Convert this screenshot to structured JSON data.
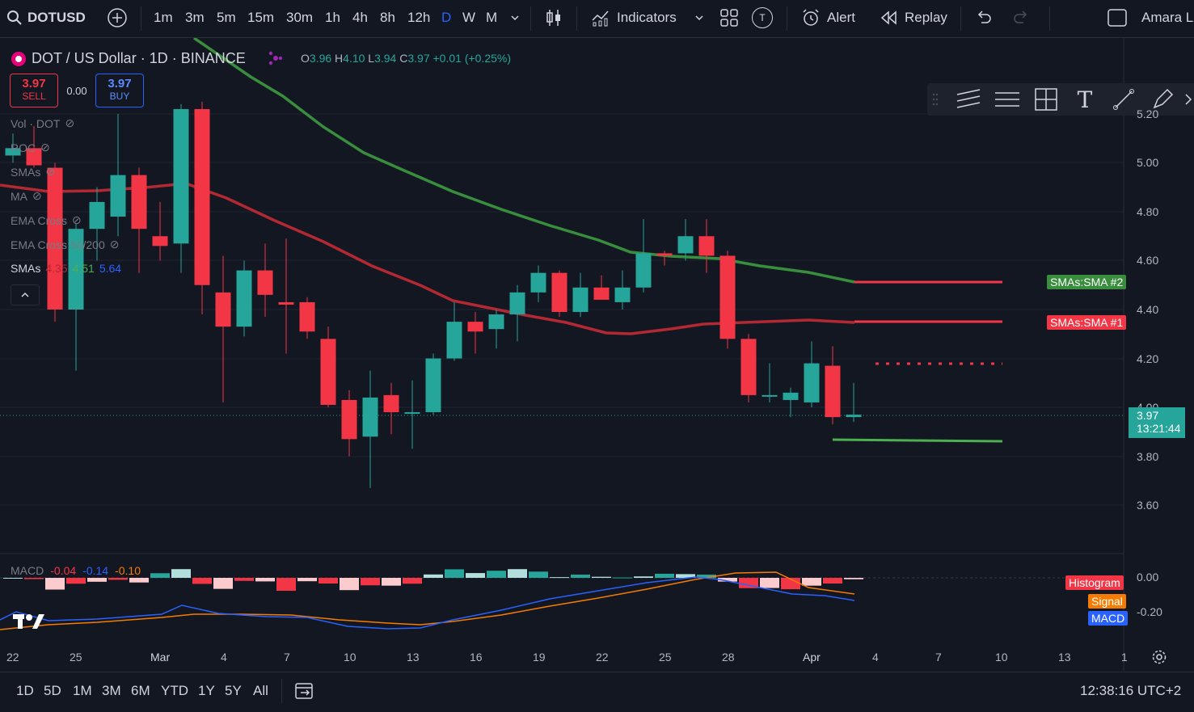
{
  "topbar": {
    "symbol": "DOTUSD",
    "intervals": [
      "1m",
      "3m",
      "5m",
      "15m",
      "30m",
      "1h",
      "4h",
      "8h",
      "12h",
      "D",
      "W",
      "M"
    ],
    "active_interval": "D",
    "indicators_label": "Indicators",
    "template_letter": "T",
    "alert_label": "Alert",
    "replay_label": "Replay",
    "user_label": "Amara L"
  },
  "header": {
    "title": "DOT / US Dollar · 1D · BINANCE",
    "ohlc": {
      "o_label": "O",
      "o": "3.96",
      "h_label": "H",
      "h": "4.10",
      "l_label": "L",
      "l": "3.94",
      "c_label": "C",
      "c": "3.97",
      "chg": "+0.01 (+0.25%)"
    },
    "sell_price": "3.97",
    "sell_label": "SELL",
    "spread": "0.00",
    "buy_price": "3.97",
    "buy_label": "BUY"
  },
  "legend": {
    "items": [
      "Vol · DOT",
      "ROC",
      "SMAs",
      "MA",
      "EMA Cross",
      "EMA Cross 50/200"
    ],
    "smas_label": "SMAs",
    "smas_v1": "4.35",
    "smas_v2": "4.51",
    "smas_v3": "5.64"
  },
  "price_axis": [
    "5.20",
    "5.00",
    "4.80",
    "4.60",
    "4.40",
    "4.20",
    "4.00",
    "3.80",
    "3.60"
  ],
  "current_price": {
    "value": "3.97",
    "countdown": "13:21:44"
  },
  "sma_tags": {
    "sma2": "SMAs:SMA #2",
    "sma1": "SMAs:SMA #1"
  },
  "macd": {
    "label": "MACD",
    "v1": "-0.04",
    "v2": "-0.14",
    "v3": "-0.10",
    "axis": [
      "0.00",
      "-0.20"
    ],
    "tags": {
      "histogram": "Histogram",
      "signal": "Signal",
      "macd": "MACD"
    }
  },
  "time_axis": [
    "22",
    "25",
    "Mar",
    "4",
    "7",
    "10",
    "13",
    "16",
    "19",
    "22",
    "25",
    "28",
    "Apr",
    "4",
    "7",
    "10",
    "13",
    "1"
  ],
  "bottombar": {
    "ranges": [
      "1D",
      "5D",
      "1M",
      "3M",
      "6M",
      "YTD",
      "1Y",
      "5Y",
      "All"
    ],
    "clock": "12:38:16 UTC+2"
  },
  "colors": {
    "up": "#26a69a",
    "down": "#f23645",
    "sma_green": "#388e3c",
    "sma_red": "#b22833",
    "macd_blue": "#2962ff",
    "signal_orange": "#f57c00"
  },
  "chart_data": {
    "type": "candlestick",
    "ylim": [
      3.5,
      5.4
    ],
    "x": [
      "Feb 21",
      "Feb 22",
      "Feb 23",
      "Feb 24",
      "Feb 25",
      "Feb 26",
      "Feb 27",
      "Feb 28",
      "Feb 29",
      "Mar 1",
      "Mar 2",
      "Mar 3",
      "Mar 4",
      "Mar 5",
      "Mar 6",
      "Mar 7",
      "Mar 8",
      "Mar 9",
      "Mar 10",
      "Mar 11",
      "Mar 12",
      "Mar 13",
      "Mar 14",
      "Mar 15",
      "Mar 16",
      "Mar 17",
      "Mar 18",
      "Mar 19",
      "Mar 20",
      "Mar 21",
      "Mar 22",
      "Mar 23",
      "Mar 24",
      "Mar 25",
      "Mar 26",
      "Mar 27",
      "Mar 28",
      "Mar 29",
      "Mar 30",
      "Mar 31",
      "Apr 1",
      "Apr 2"
    ],
    "candles": [
      {
        "o": 5.03,
        "h": 5.12,
        "l": 5.0,
        "c": 5.06
      },
      {
        "o": 5.06,
        "h": 5.15,
        "l": 4.98,
        "c": 4.99
      },
      {
        "o": 4.98,
        "h": 5.0,
        "l": 4.35,
        "c": 4.4
      },
      {
        "o": 4.4,
        "h": 4.75,
        "l": 4.15,
        "c": 4.73
      },
      {
        "o": 4.73,
        "h": 4.9,
        "l": 4.6,
        "c": 4.84
      },
      {
        "o": 4.78,
        "h": 5.2,
        "l": 4.7,
        "c": 4.95
      },
      {
        "o": 4.95,
        "h": 4.98,
        "l": 4.55,
        "c": 4.73
      },
      {
        "o": 4.7,
        "h": 4.84,
        "l": 4.6,
        "c": 4.66
      },
      {
        "o": 4.67,
        "h": 5.24,
        "l": 4.55,
        "c": 5.22
      },
      {
        "o": 5.22,
        "h": 5.25,
        "l": 4.38,
        "c": 4.5
      },
      {
        "o": 4.47,
        "h": 4.62,
        "l": 4.02,
        "c": 4.33
      },
      {
        "o": 4.33,
        "h": 4.6,
        "l": 4.29,
        "c": 4.56
      },
      {
        "o": 4.56,
        "h": 4.67,
        "l": 4.37,
        "c": 4.46
      },
      {
        "o": 4.43,
        "h": 4.69,
        "l": 4.22,
        "c": 4.42
      },
      {
        "o": 4.43,
        "h": 4.45,
        "l": 4.28,
        "c": 4.31
      },
      {
        "o": 4.28,
        "h": 4.33,
        "l": 4.0,
        "c": 4.01
      },
      {
        "o": 4.03,
        "h": 4.07,
        "l": 3.8,
        "c": 3.87
      },
      {
        "o": 3.88,
        "h": 4.15,
        "l": 3.67,
        "c": 4.04
      },
      {
        "o": 4.05,
        "h": 4.1,
        "l": 3.89,
        "c": 3.98
      },
      {
        "o": 3.98,
        "h": 4.11,
        "l": 3.83,
        "c": 3.98
      },
      {
        "o": 3.98,
        "h": 4.22,
        "l": 3.97,
        "c": 4.2
      },
      {
        "o": 4.2,
        "h": 4.43,
        "l": 4.19,
        "c": 4.35
      },
      {
        "o": 4.35,
        "h": 4.39,
        "l": 4.22,
        "c": 4.31
      },
      {
        "o": 4.32,
        "h": 4.4,
        "l": 4.24,
        "c": 4.38
      },
      {
        "o": 4.38,
        "h": 4.5,
        "l": 4.27,
        "c": 4.47
      },
      {
        "o": 4.47,
        "h": 4.58,
        "l": 4.43,
        "c": 4.55
      },
      {
        "o": 4.55,
        "h": 4.56,
        "l": 4.37,
        "c": 4.39
      },
      {
        "o": 4.39,
        "h": 4.55,
        "l": 4.37,
        "c": 4.49
      },
      {
        "o": 4.49,
        "h": 4.54,
        "l": 4.44,
        "c": 4.44
      },
      {
        "o": 4.43,
        "h": 4.56,
        "l": 4.4,
        "c": 4.49
      },
      {
        "o": 4.49,
        "h": 4.77,
        "l": 4.47,
        "c": 4.63
      },
      {
        "o": 4.63,
        "h": 4.64,
        "l": 4.58,
        "c": 4.62
      },
      {
        "o": 4.63,
        "h": 4.77,
        "l": 4.6,
        "c": 4.7
      },
      {
        "o": 4.7,
        "h": 4.77,
        "l": 4.55,
        "c": 4.62
      },
      {
        "o": 4.62,
        "h": 4.64,
        "l": 4.24,
        "c": 4.28
      },
      {
        "o": 4.28,
        "h": 4.3,
        "l": 4.02,
        "c": 4.05
      },
      {
        "o": 4.05,
        "h": 4.18,
        "l": 4.02,
        "c": 4.05
      },
      {
        "o": 4.03,
        "h": 4.08,
        "l": 3.96,
        "c": 4.06
      },
      {
        "o": 4.02,
        "h": 4.27,
        "l": 4.0,
        "c": 4.18
      },
      {
        "o": 4.17,
        "h": 4.25,
        "l": 3.93,
        "c": 3.96
      },
      {
        "o": 3.96,
        "h": 4.1,
        "l": 3.94,
        "c": 3.97
      }
    ]
  }
}
